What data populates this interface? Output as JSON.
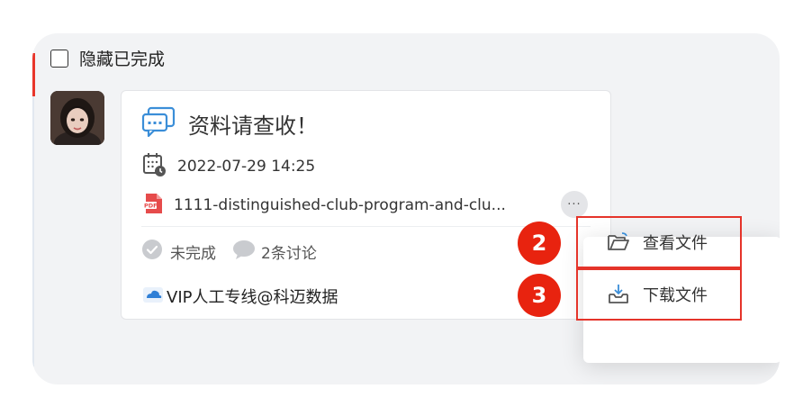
{
  "filter": {
    "hide_completed_label": "隐藏已完成"
  },
  "task": {
    "title": "资料请查收！",
    "datetime": "2022-07-29 14:25",
    "file_name": "1111-distinguished-club-program-and-clu...",
    "more_label": "···",
    "status_label": "未完成",
    "comment_label": "2条讨论",
    "source_label": "VIP人工专线@科迈数据"
  },
  "context_menu": {
    "items": [
      {
        "label": "查看文件",
        "badge": "2",
        "icon": "folder-open-icon"
      },
      {
        "label": "下载文件",
        "badge": "3",
        "icon": "download-icon"
      }
    ]
  },
  "colors": {
    "accent_red": "#e8230f",
    "highlight_border": "#e5342a",
    "chat_icon_blue": "#3b8ed8",
    "pdf_red": "#e64b4b"
  }
}
